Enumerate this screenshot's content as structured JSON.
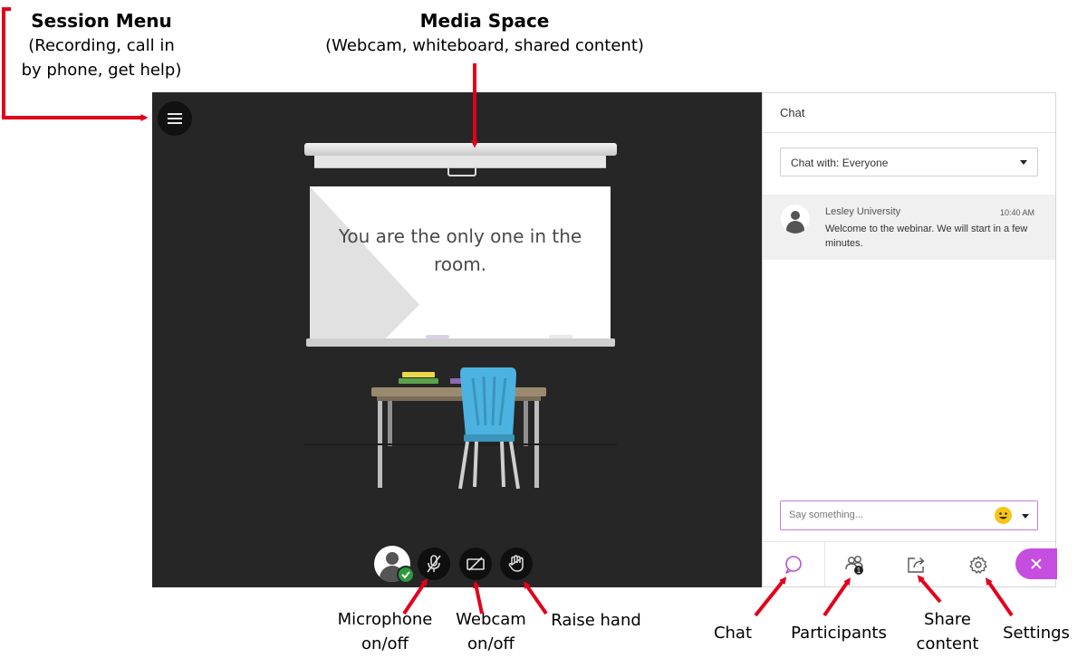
{
  "annotations": {
    "session_menu": {
      "title": "Session Menu",
      "line1": "(Recording, call in",
      "line2": "by phone, get help)"
    },
    "media_space": {
      "title": "Media Space",
      "subtitle": "(Webcam, whiteboard, shared content)"
    },
    "microphone": {
      "line1": "Microphone",
      "line2": "on/off"
    },
    "webcam": {
      "line1": "Webcam",
      "line2": "on/off"
    },
    "raise_hand": "Raise hand",
    "chat": "Chat",
    "participants": "Participants",
    "share": {
      "line1": "Share",
      "line2": "content"
    },
    "settings": "Settings"
  },
  "stage": {
    "room_message": "You are the only one in the room."
  },
  "chat_panel": {
    "title": "Chat",
    "chat_with": "Chat with: Everyone",
    "message": {
      "author": "Lesley University",
      "time": "10:40 AM",
      "text": "Welcome to the webinar. We will start in a few minutes."
    },
    "input_placeholder": "Say something...",
    "participant_count": "1"
  },
  "colors": {
    "annotation_red": "#e3001b",
    "accent_purple": "#c54ee0",
    "stage_background": "#262626",
    "chair_blue": "#4cb3e0",
    "online_green": "#2c9a3f"
  },
  "icons": [
    "menu-icon",
    "microphone-off-icon",
    "webcam-off-icon",
    "raise-hand-icon",
    "chat-icon",
    "participants-icon",
    "share-icon",
    "settings-icon",
    "close-icon",
    "emoji-icon"
  ]
}
